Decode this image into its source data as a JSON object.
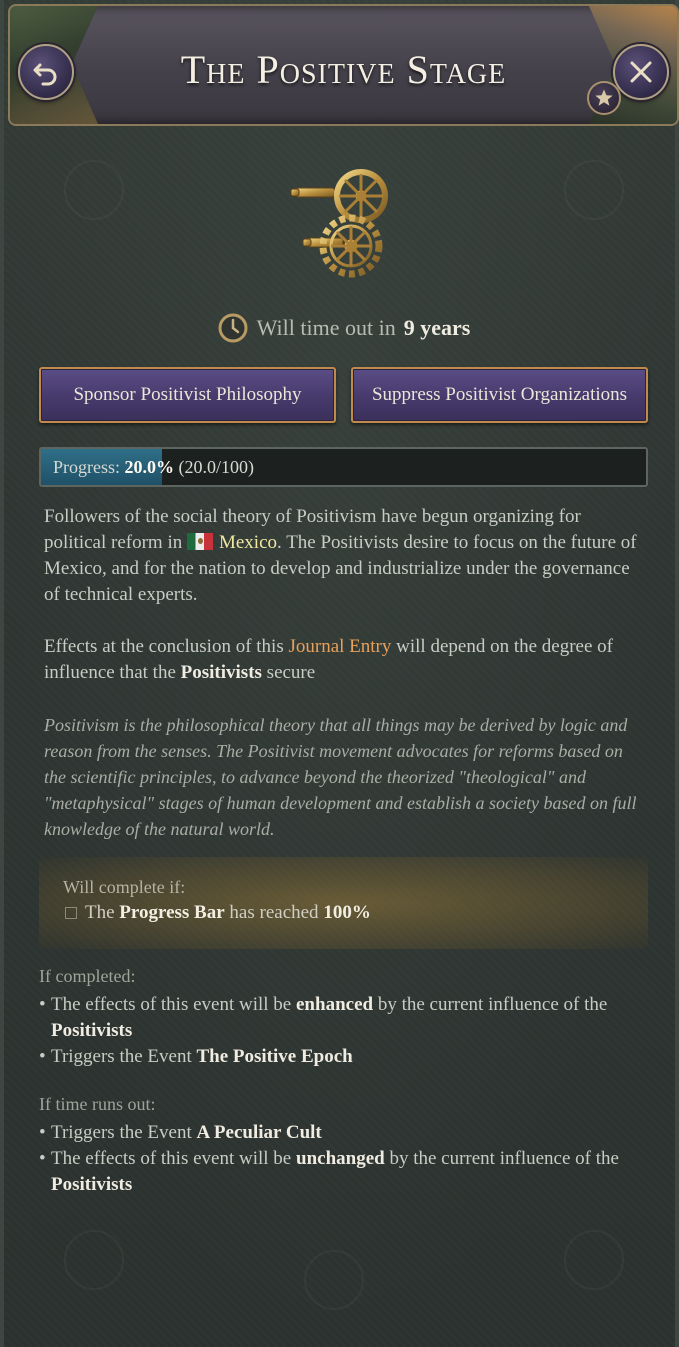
{
  "header": {
    "title": "The Positive Stage",
    "back_icon": "back-arrow-icon",
    "close_icon": "close-icon",
    "pin_icon": "star-icon"
  },
  "journal_icon": "gears-icon",
  "timeout": {
    "prefix": "Will time out in",
    "value": "9 years"
  },
  "actions": {
    "sponsor": "Sponsor Positivist Philosophy",
    "suppress": "Suppress Positivist Organizations"
  },
  "progress": {
    "label": "Progress:",
    "percent": "20.0%",
    "detail": "(20.0/100)",
    "fraction": 0.2
  },
  "description": {
    "p1_a": "Followers of the social theory of Positivism have begun organizing for political reform in",
    "country": "Mexico",
    "p1_b": ". The Positivists desire to focus on the future of Mexico, and for the nation to develop and industrialize under the governance of technical experts.",
    "p2_a": "Effects at the conclusion of this",
    "journal_entry": "Journal Entry",
    "p2_b": "will depend on the degree of influence that the",
    "positivists": "Positivists",
    "p2_c": "secure"
  },
  "flavor_text": "Positivism is the philosophical theory that all things may be derived by logic and reason from the senses. The Positivist movement advocates for reforms based on the scientific principles, to advance beyond the theorized \"theological\" and \"metaphysical\" stages of human development and establish a society based on full knowledge of the natural world.",
  "completion": {
    "title": "Will complete if:",
    "pre": "The",
    "subject": "Progress Bar",
    "mid": "has reached",
    "target": "100%"
  },
  "if_completed": {
    "title": "If completed:",
    "b1_a": "The effects of this event will be",
    "b1_bold": "enhanced",
    "b1_b": "by the current influence of the",
    "b1_group": "Positivists",
    "b2_a": "Triggers the Event",
    "b2_event": "The Positive Epoch"
  },
  "if_timeout": {
    "title": "If time runs out:",
    "b1_a": "Triggers the Event",
    "b1_event": "A Peculiar Cult",
    "b2_a": "The effects of this event will be",
    "b2_bold": "unchanged",
    "b2_b": "by the current influence of the",
    "b2_group": "Positivists"
  },
  "colors": {
    "button_bg": "#463a6c",
    "button_border": "#c08a4a",
    "progress_fill": "#2f6f88",
    "link_orange": "#e8a05a",
    "country_yellow": "#f1e8a0"
  }
}
